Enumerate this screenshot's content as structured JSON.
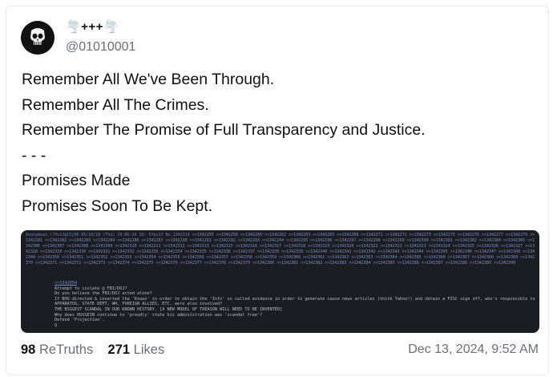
{
  "post": {
    "author": {
      "display_name": "🌪️+++🌪️",
      "handle": "@01010001",
      "avatar_icon": "punisher-skull-icon"
    },
    "lines": [
      "Remember All We've Been Through.",
      "Remember All The Crimes.",
      "Remember The Promise of Full Transparency and Justice.",
      "- - -",
      "Promises Made",
      "Promises Soon To Be Kept."
    ],
    "media": {
      "header_line": "Anonymous !!Hs1Jq13jV6 05/10/18 (Thu) 10:06:26 ID: 5fbc2f  No.1342314",
      "reply_links": ">>1342255 >>1342258 >>1342260 >>1342262 >>1342263 >>1342265 >>1342268 >>1342271 >>1342272 >>1342273 >>1342275 >>1342276 >>1342277 >>1342279 >>1342281 >>1342282 >>1342283 >>1342284 >>1342286 >>1342287 >>1342290 >>1342291 >>1342292 >>1342293 >>1342294 >>1342295 >>1342296 >>1342297 >>1342298 >>1342299 >>1342300 >>1342301 >>1342302 >>1342304 >>1342305 >>1342306 >>1342307 >>1342308 >>1342309 >>1342310 >>1342311 >>1342312 >>1342313 >>1342315 >>1342316 >>1342317 >>1342318 >>1342319 >>1342320 >>1342321 >>1342322 >>1342323 >>1342324 >>1342325 >>1342326 >>1342327 >>1342328 >>1342329 >>1342330 >>1342331 >>1342332 >>1342333 >>1342334 >>1342335 >>1342336 >>1342337 >>1342338 >>1342339 >>1342340 >>1342341 >>1342342 >>1342343 >>1342344 >>1342345 >>1342346 >>1342347 >>1342348 >>1342349 >>1342350 >>1342351 >>1342352 >>1342353 >>1342354 >>1342355 >>1342356 >>1342357 >>1342358 >>1342359 >>1342360 >>1342361 >>1342362 >>1342363 >>1342364 >>1342365 >>1342366 >>1342367 >>1342368 >>1342369 >>1342370 >>1342371 >>1342372 >>1342373 >>1342374 >>1342375 >>1342376 >>1342377 >>1342378 >>1342379 >>1342380 >>1342381 >>1342382 >>1342383 >>1342384 >>1342385 >>1342386 >>1342387 >>1342388 >>1342389 >>1342390",
      "body_lines": [
        ">>1342054",
        "Attempt to isolate @ FBI/DOJ?",
        "Do you believe the FBI/DOJ acted alone?",
        "If BHO directed & inserted the 'Knows' in order to obtain the 'Info' so called evidence in order to generate cause news articles (think Yahoo!) and obtain a FISC sign off, who's responsible to think that members of the INTEL",
        "APPARATUS, STATE DEPT, WH, FOREIGN ALLIES, ETC. were also involved?",
        "THE BIGGEST SCANDAL IN OUR KNOWN HISTORY. [A NEW MODEL OF TREASON WILL NEED TO BE INVENTED]",
        "Why does HUSSEIN continue to 'proudly' state his administration was 'scandal free'?",
        "Defend 'Projection'.",
        "Q"
      ]
    },
    "stats": {
      "retruths_count": "98",
      "retruths_label": "ReTruths",
      "likes_count": "271",
      "likes_label": "Likes"
    },
    "timestamp": "Dec 13, 2024, 9:52 AM"
  },
  "colors": {
    "text": "#0f0f14",
    "muted": "#6b6e7a",
    "media_bg": "#1b1d22",
    "link": "#6d8fd0"
  }
}
